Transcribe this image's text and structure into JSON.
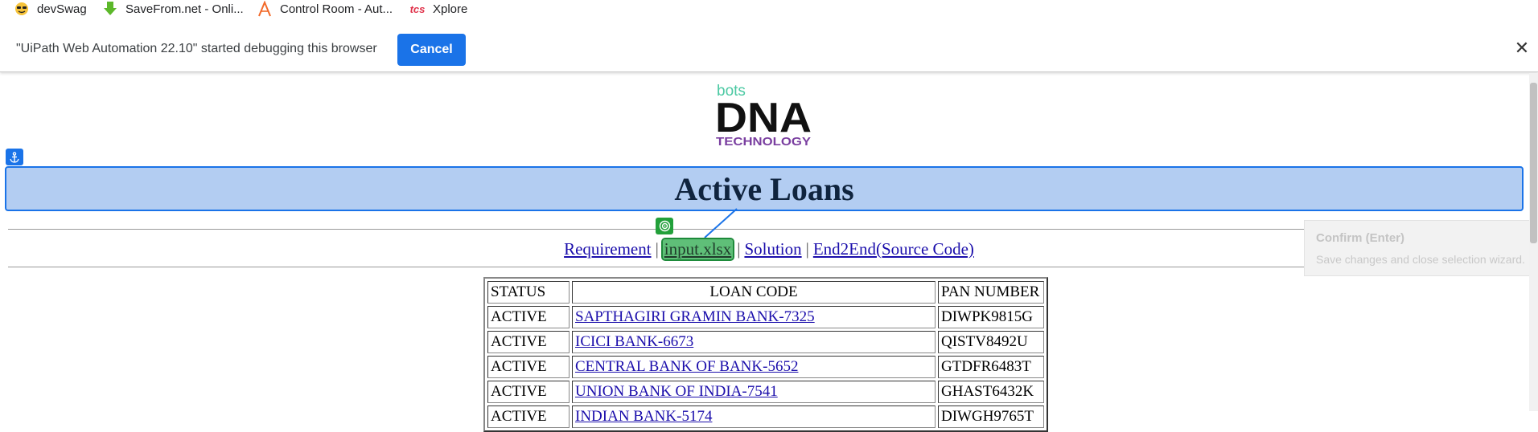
{
  "bookmarks": [
    {
      "label": "devSwag",
      "icon": "smiley-icon"
    },
    {
      "label": "SaveFrom.net - Onli...",
      "icon": "download-arrow-icon"
    },
    {
      "label": "Control Room - Aut...",
      "icon": "automation-anywhere-icon"
    },
    {
      "label": "Xplore",
      "icon": "tcs-icon"
    }
  ],
  "infobar": {
    "message": "\"UiPath Web Automation 22.10\" started debugging this browser",
    "cancel_label": "Cancel",
    "close_symbol": "✕"
  },
  "logo": {
    "line1": "bots",
    "line2": "DNA",
    "line3": "TECHNOLOGY"
  },
  "page": {
    "title": "Active Loans"
  },
  "nav": {
    "links": [
      "Requirement",
      "input.xlsx",
      "Solution",
      "End2End(Source Code)"
    ],
    "separator": "|"
  },
  "tooltip": {
    "title": "Confirm (Enter)",
    "text": "Save changes and close selection wizard."
  },
  "table": {
    "headers": [
      "STATUS",
      "LOAN CODE",
      "PAN NUMBER"
    ],
    "rows": [
      [
        "ACTIVE",
        "SAPTHAGIRI GRAMIN BANK-7325",
        "DIWPK9815G"
      ],
      [
        "ACTIVE",
        "ICICI BANK-6673",
        "QISTV8492U"
      ],
      [
        "ACTIVE",
        "CENTRAL BANK OF BANK-5652",
        "GTDFR6483T"
      ],
      [
        "ACTIVE",
        "UNION BANK OF INDIA-7541",
        "GHAST6432K"
      ],
      [
        "ACTIVE",
        "INDIAN BANK-5174",
        "DIWGH9765T"
      ]
    ]
  },
  "colors": {
    "accent": "#1a73e8",
    "highlight_blue": "#b3cdf2",
    "highlight_green": "#5fbf78",
    "link": "#1a0dab"
  }
}
